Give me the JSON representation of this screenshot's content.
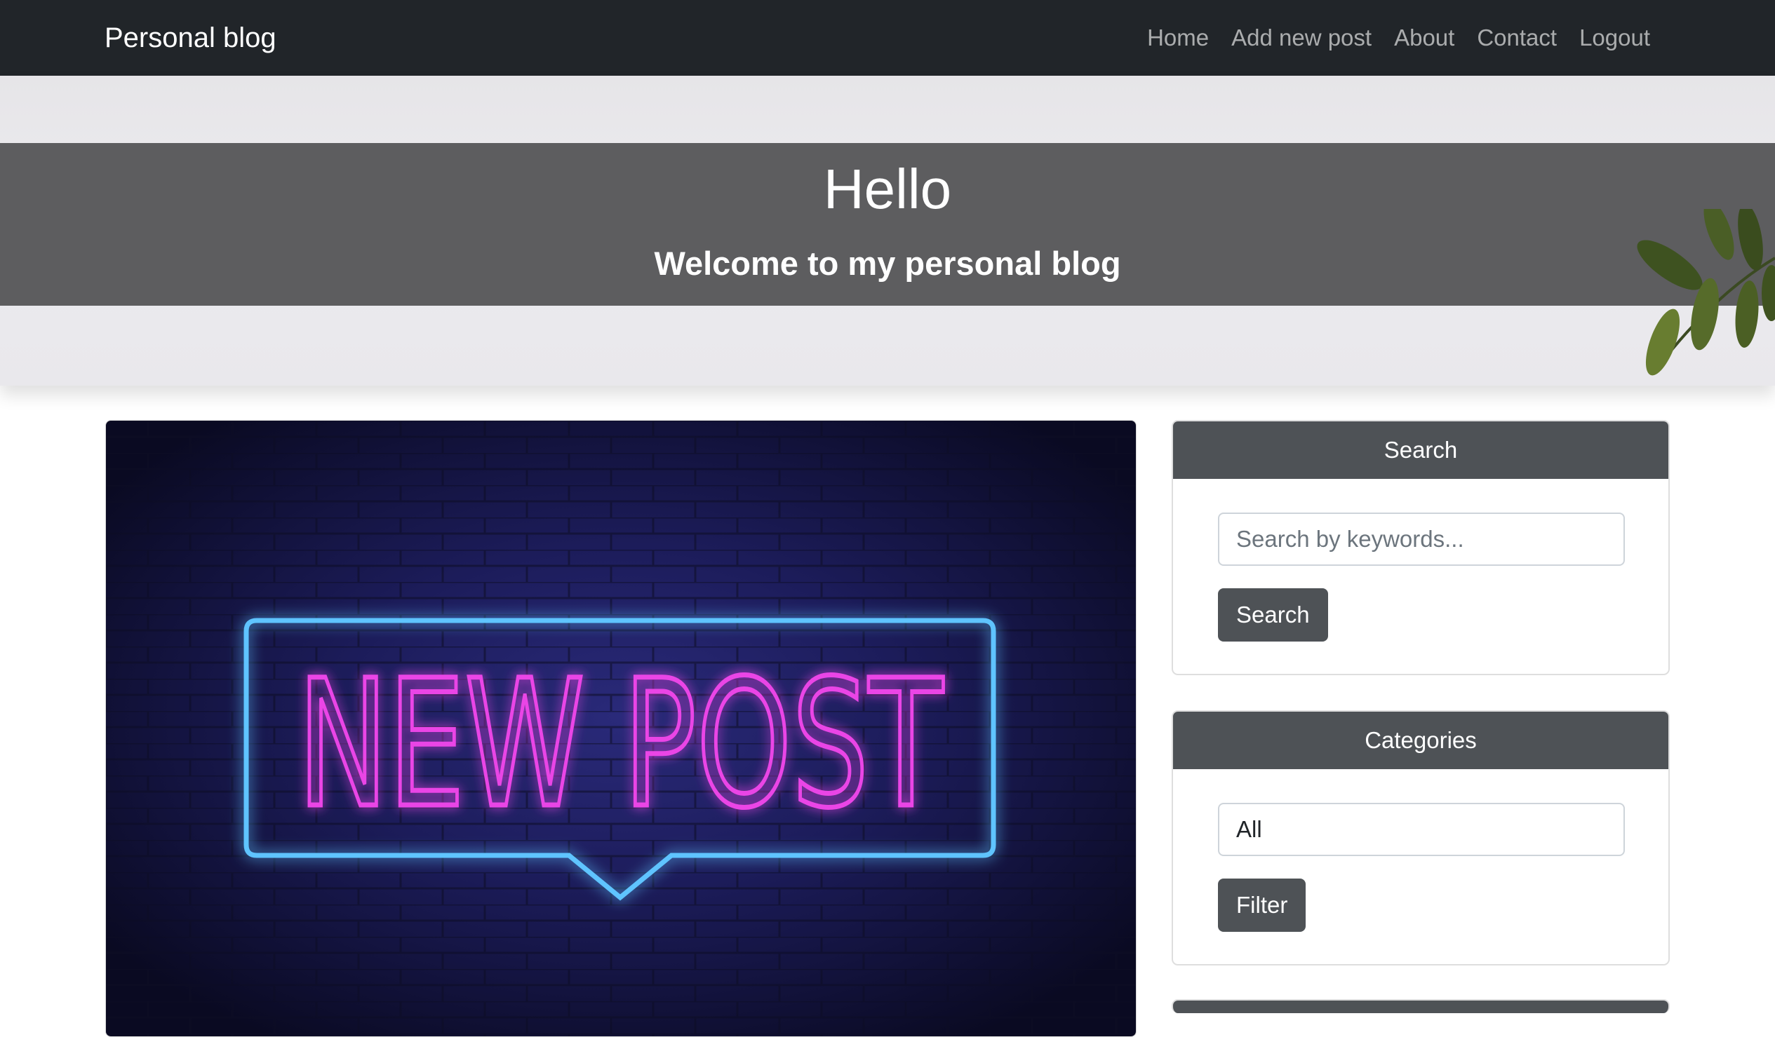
{
  "navbar": {
    "brand": "Personal blog",
    "links": [
      "Home",
      "Add new post",
      "About",
      "Contact",
      "Logout"
    ]
  },
  "hero": {
    "title": "Hello",
    "subtitle": "Welcome to my personal blog"
  },
  "post": {
    "image_text": "NEW POST"
  },
  "sidebar": {
    "search": {
      "header": "Search",
      "placeholder": "Search by keywords...",
      "button": "Search"
    },
    "categories": {
      "header": "Categories",
      "value": "All",
      "button": "Filter"
    }
  },
  "colors": {
    "navbar": "#212529",
    "card_header": "#4e5256",
    "neon_pink": "#e23ee0",
    "neon_blue": "#4fb6ff"
  }
}
